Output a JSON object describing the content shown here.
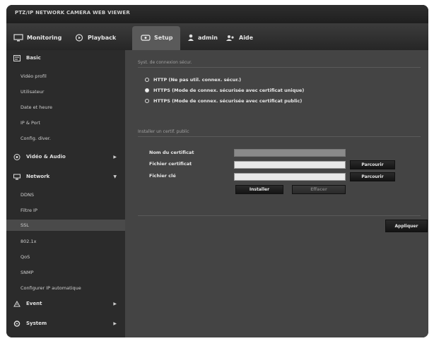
{
  "window": {
    "title": "PTZ/IP NETWORK CAMERA WEB VIEWER"
  },
  "nav": {
    "monitoring": "Monitoring",
    "playback": "Playback",
    "setup": "Setup",
    "user": "admin",
    "help": "Aide"
  },
  "sidebar": {
    "items": [
      {
        "label": "Basic",
        "type": "header",
        "icon": "tools-icon"
      },
      {
        "label": "Vidéo profil",
        "type": "sub"
      },
      {
        "label": "Utilisateur",
        "type": "sub"
      },
      {
        "label": "Date et heure",
        "type": "sub"
      },
      {
        "label": "IP & Port",
        "type": "sub"
      },
      {
        "label": "Config. diver.",
        "type": "sub"
      },
      {
        "label": "Vidéo & Audio",
        "type": "header",
        "icon": "video-icon",
        "arrow": "▶"
      },
      {
        "label": "Network",
        "type": "header",
        "icon": "network-icon",
        "arrow": "▼"
      },
      {
        "label": "DDNS",
        "type": "sub"
      },
      {
        "label": "Filtre IP",
        "type": "sub"
      },
      {
        "label": "SSL",
        "type": "sub",
        "selected": true
      },
      {
        "label": "802.1x",
        "type": "sub"
      },
      {
        "label": "QoS",
        "type": "sub"
      },
      {
        "label": "SNMP",
        "type": "sub"
      },
      {
        "label": "Configurer IP automatique",
        "type": "sub"
      },
      {
        "label": "Event",
        "type": "header",
        "icon": "event-icon",
        "arrow": "▶"
      },
      {
        "label": "System",
        "type": "header",
        "icon": "system-icon",
        "arrow": "▶"
      }
    ]
  },
  "content": {
    "section1_title": "Syst. de connexion sécur.",
    "radio_options": [
      {
        "label": "HTTP (Ne pas util. connex. sécur.)",
        "selected": false
      },
      {
        "label": "HTTPS (Mode de connex. sécurisée avec certificat unique)",
        "selected": true
      },
      {
        "label": "HTTPS (Mode de connex. sécurisée avec certificat public)",
        "selected": false
      }
    ],
    "section2_title": "Installer un certif. public",
    "fields": {
      "cert_name_label": "Nom du certificat",
      "cert_file_label": "Fichier certificat",
      "key_file_label": "Fichier clé",
      "cert_name_value": "",
      "cert_file_value": "",
      "key_file_value": ""
    },
    "buttons": {
      "browse": "Parcourir",
      "install": "Installer",
      "delete": "Effacer",
      "apply": "Appliquer"
    }
  },
  "colors": {
    "accent": "#5a5a5a",
    "panel": "#444444",
    "sidebar": "#2b2b2b"
  }
}
